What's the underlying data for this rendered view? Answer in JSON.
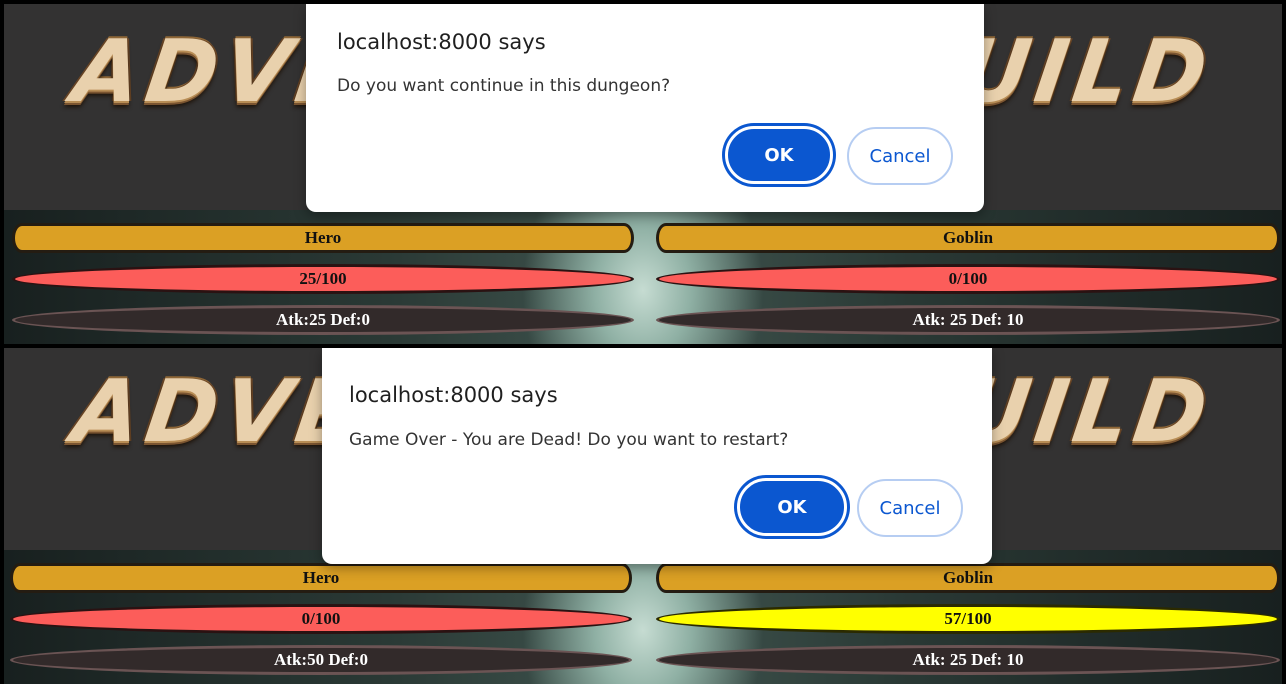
{
  "game": {
    "logo_left": "ADVE",
    "logo_right": "UILD"
  },
  "screens": [
    {
      "dialog": {
        "title": "localhost:8000 says",
        "message": "Do you want continue in this dungeon?",
        "ok_label": "OK",
        "cancel_label": "Cancel"
      },
      "hero": {
        "name": "Hero",
        "hp": "25/100",
        "hp_fraction": 0.25,
        "stats": "Atk:25 Def:0"
      },
      "enemy": {
        "name": "Goblin",
        "hp": "0/100",
        "hp_fraction": 0.0,
        "stats": "Atk: 25 Def: 10"
      }
    },
    {
      "dialog": {
        "title": "localhost:8000 says",
        "message": "Game Over - You are Dead! Do you want to restart?",
        "ok_label": "OK",
        "cancel_label": "Cancel"
      },
      "hero": {
        "name": "Hero",
        "hp": "0/100",
        "hp_fraction": 0.0,
        "stats": "Atk:50 Def:0"
      },
      "enemy": {
        "name": "Goblin",
        "hp": "57/100",
        "hp_fraction": 0.57,
        "stats": "Atk: 25 Def: 10"
      }
    }
  ],
  "colors": {
    "name_bar": "#dba024",
    "hp_low": "#fc5d5a",
    "hp_mid": "#ffff00",
    "stats_bar": "#322a2a",
    "dialog_accent": "#0b57d0"
  }
}
